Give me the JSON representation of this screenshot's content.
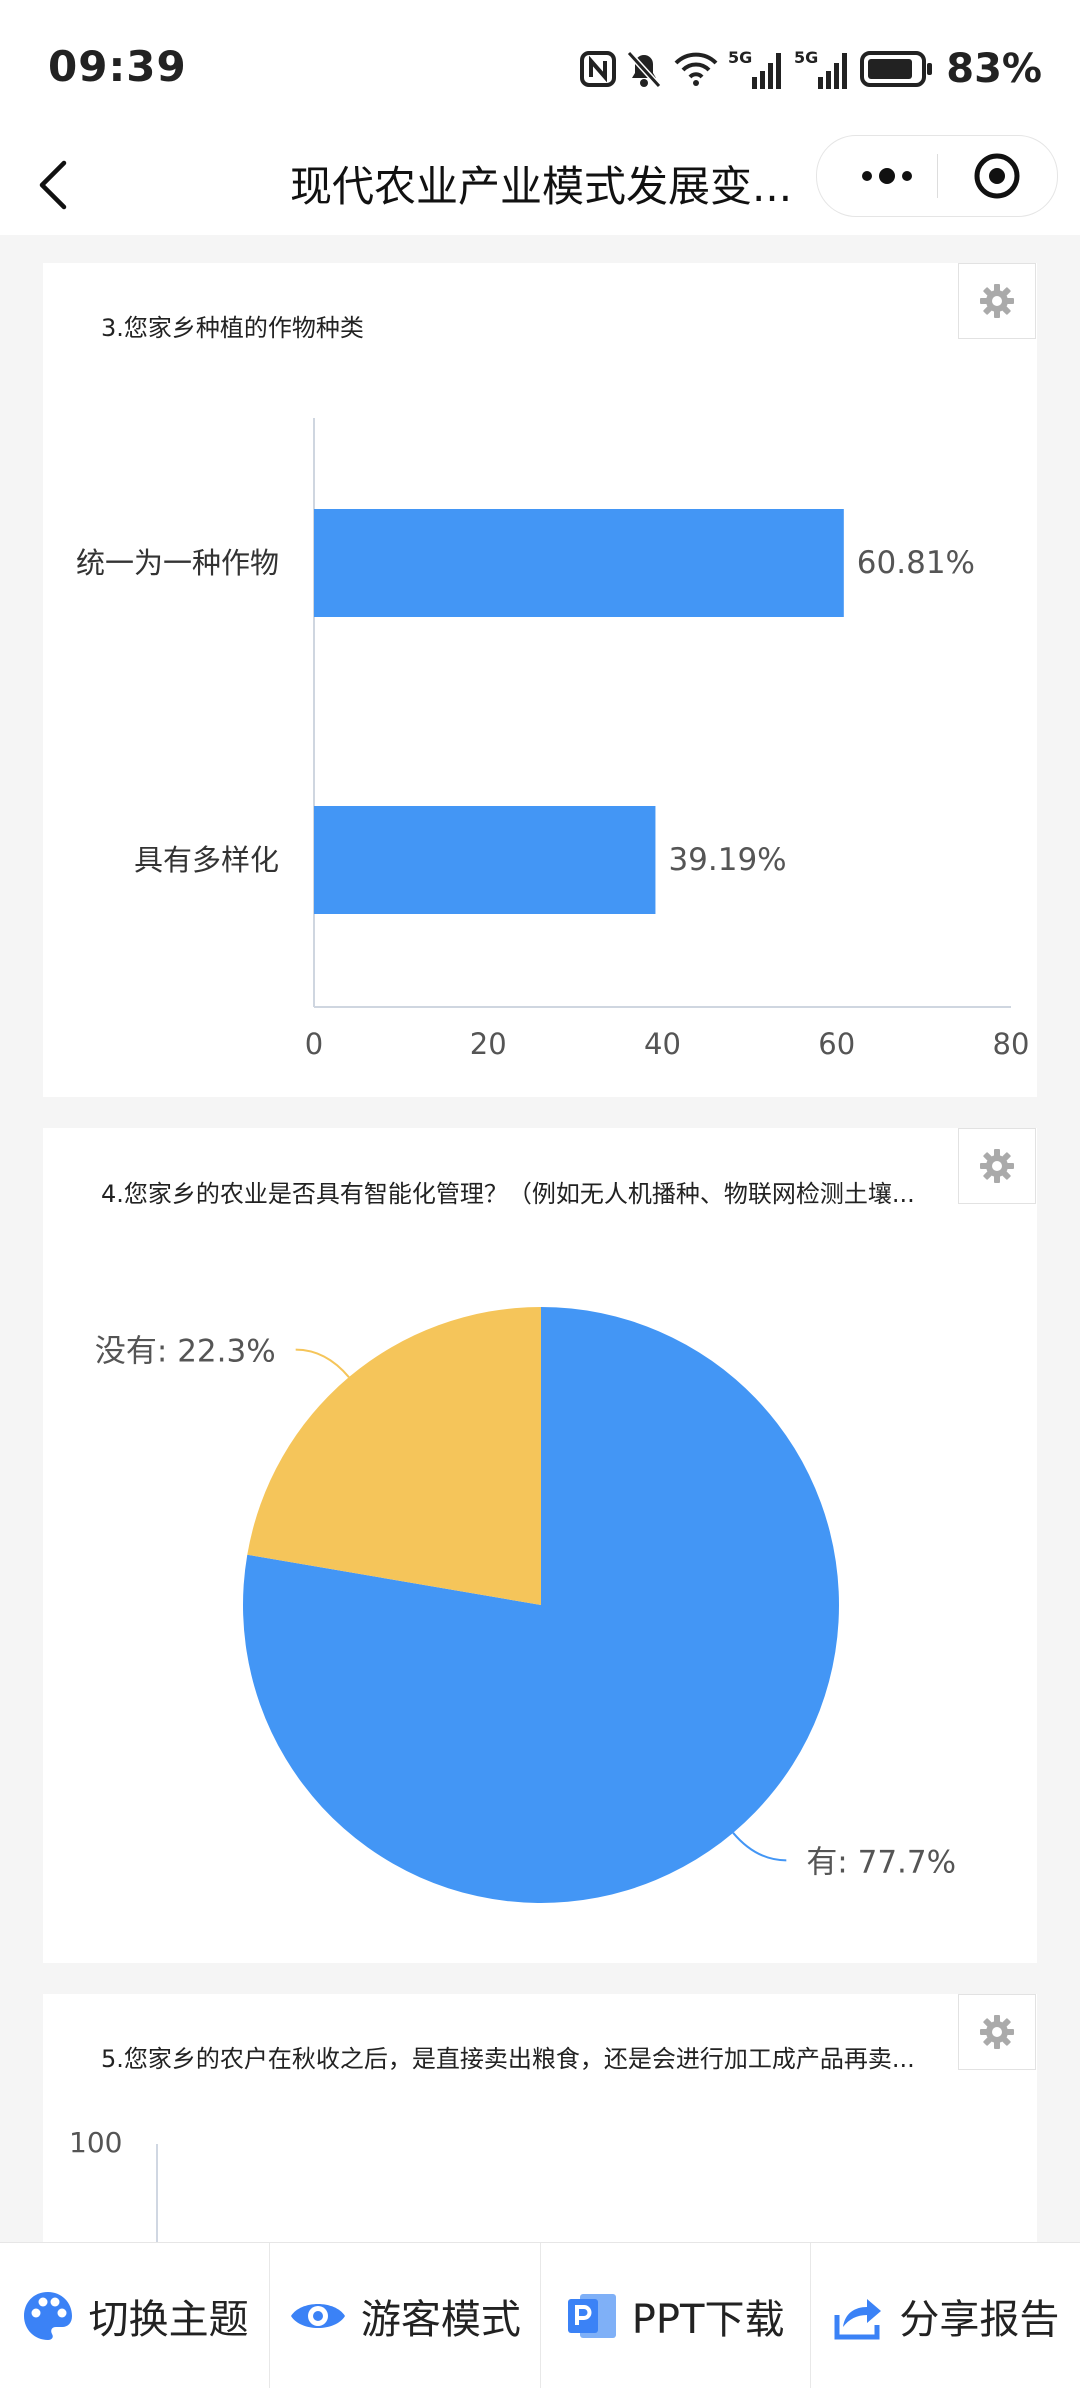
{
  "status": {
    "time": "09:39",
    "battery": "83%",
    "net1": "5G",
    "net2": "5G"
  },
  "nav": {
    "title": "现代农业产业模式发展变..."
  },
  "q3": {
    "title": "3.您家乡种植的作物种类",
    "chart_data": {
      "type": "bar",
      "orientation": "horizontal",
      "categories": [
        "统一为一种作物",
        "具有多样化"
      ],
      "values": [
        60.81,
        39.19
      ],
      "value_labels": [
        "60.81%",
        "39.19%"
      ],
      "xlim": [
        0,
        80
      ],
      "xticks": [
        "0",
        "20",
        "40",
        "60",
        "80"
      ],
      "color": "#4396f5"
    }
  },
  "q4": {
    "title": "4.您家乡的农业是否具有智能化管理？（例如无人机播种、物联网检测土壤...",
    "chart_data": {
      "type": "pie",
      "slices": [
        {
          "label": "有",
          "value": 77.7,
          "text": "有: 77.7%",
          "color": "#4396f5"
        },
        {
          "label": "没有",
          "value": 22.3,
          "text": "没有: 22.3%",
          "color": "#f5c55a"
        }
      ]
    }
  },
  "q5": {
    "title": "5.您家乡的农户在秋收之后，是直接卖出粮食，还是会进行加工成产品再卖...",
    "chart_data": {
      "type": "bar",
      "yticks": [
        "100"
      ]
    }
  },
  "toolbar": {
    "theme": "切换主题",
    "guest": "游客模式",
    "ppt": "PPT下载",
    "share": "分享报告"
  }
}
